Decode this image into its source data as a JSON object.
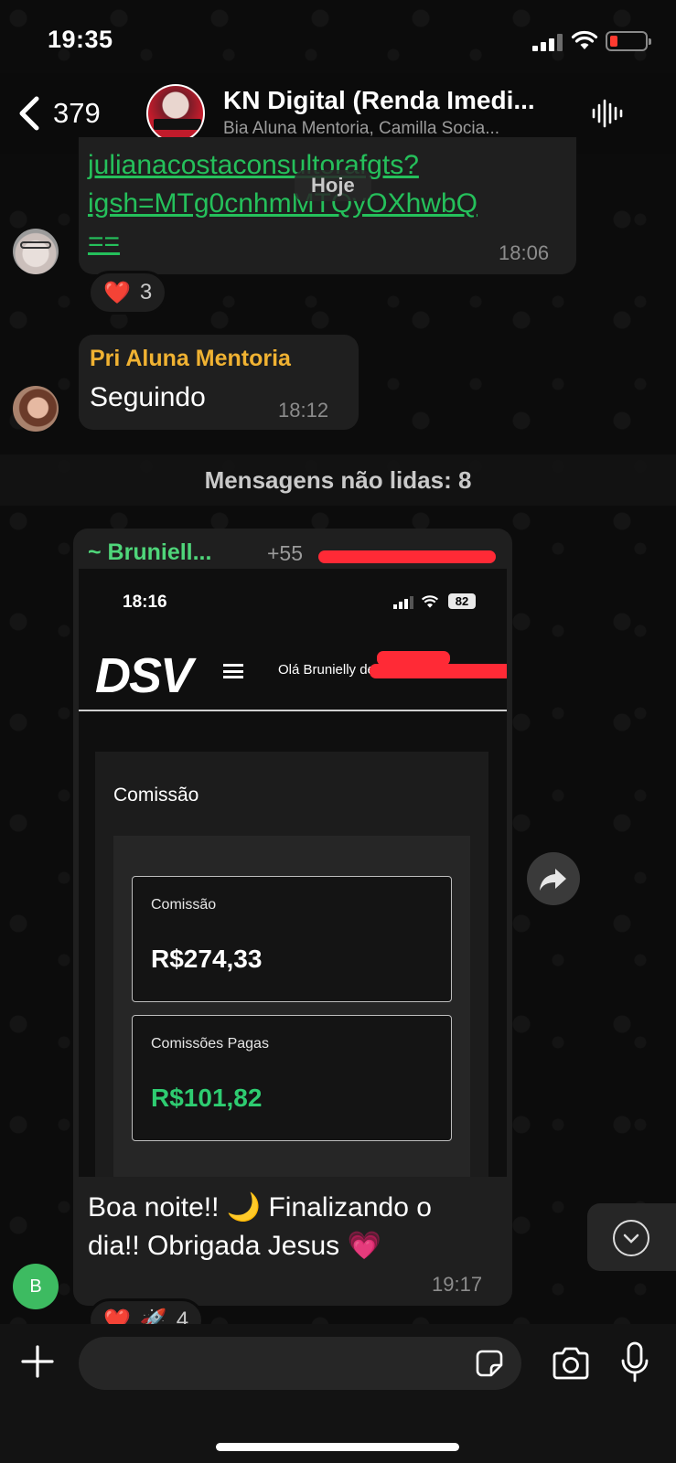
{
  "status_bar": {
    "time": "19:35"
  },
  "header": {
    "back_count": "379",
    "title": "KN Digital (Renda Imedi...",
    "subtitle": "Bia Aluna  Mentoria, Camilla Socia..."
  },
  "messages": {
    "link_line1": "julianacostaconsultorafgts?",
    "link_line2": "igsh=MTg0cnhmMTQyOXhwbQ",
    "link_line3": "==",
    "link_time": "18:06",
    "date_chip": "Hoje",
    "reaction1_count": "3",
    "pri_name": "Pri Aluna Mentoria",
    "pri_text": "Seguindo",
    "pri_time": "18:12",
    "unread_label": "Mensagens não lidas: 8",
    "brun_name": "~ Bruniell...",
    "brun_phone": "+55",
    "brun_text_line1": "Boa noite!! 🌙 Finalizando o",
    "brun_text_line2": "dia!! Obrigada Jesus 💗",
    "brun_time": "19:17",
    "reaction2_count": "4",
    "sender_avatar_letter": "B"
  },
  "screenshot": {
    "time": "18:16",
    "battery": "82",
    "logo": "DSV",
    "greeting": "Olá Brunielly de An        va",
    "panel_title": "Comissão",
    "card1_label": "Comissão",
    "card1_value": "R$274,33",
    "card2_label": "Comissões Pagas",
    "card2_value": "R$101,82"
  },
  "input": {
    "placeholder": ""
  },
  "colors": {
    "link": "#25c05b",
    "pri_name": "#f0b232",
    "brun_name": "#4fd67a",
    "paid_value": "#2ecc71",
    "redaction": "#ff2a36"
  }
}
